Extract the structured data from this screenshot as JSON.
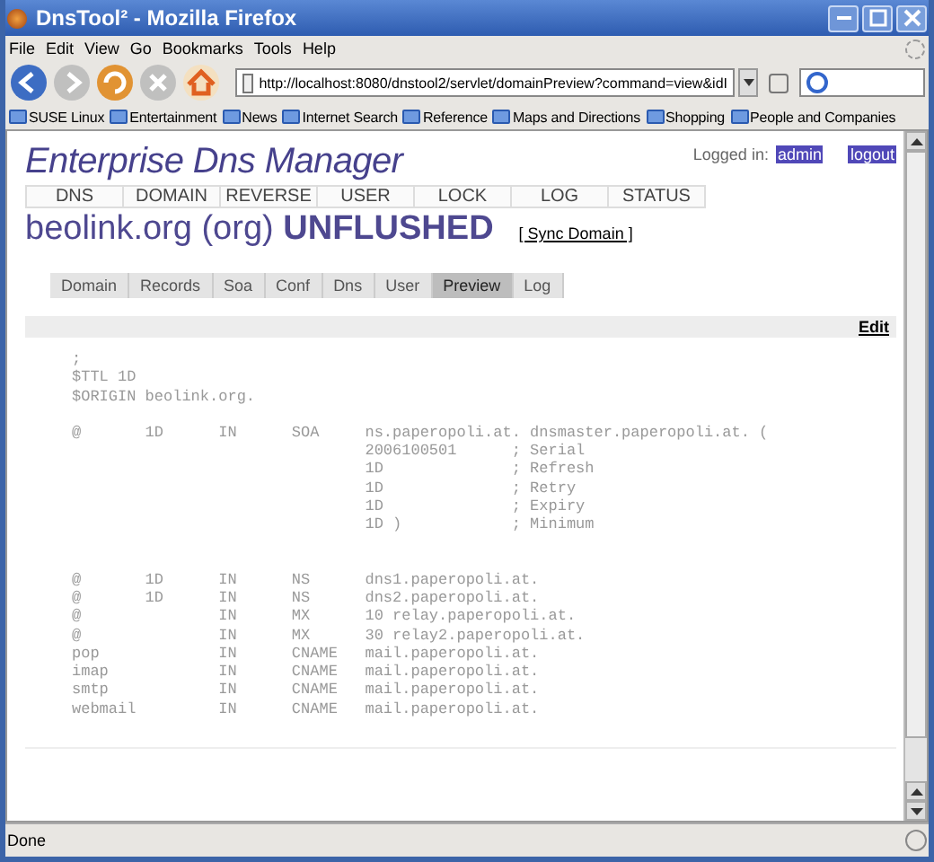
{
  "window": {
    "title": "DnsTool² - Mozilla Firefox"
  },
  "menu": [
    "File",
    "Edit",
    "View",
    "Go",
    "Bookmarks",
    "Tools",
    "Help"
  ],
  "address": {
    "value": "http://localhost:8080/dnstool2/servlet/domainPreview?command=view&idI"
  },
  "bookmarks": [
    "SUSE Linux",
    "Entertainment",
    "News",
    "Internet Search",
    "Reference",
    "Maps and Directions",
    "Shopping",
    "People and Companies"
  ],
  "page": {
    "app_title": "Enterprise Dns Manager",
    "logged_in_label": "Logged in:",
    "user": "admin",
    "logout": "logout",
    "nav": [
      "DNS",
      "DOMAIN",
      "REVERSE",
      "USER",
      "LOCK",
      "LOG",
      "STATUS"
    ],
    "domain": "beolink.org (org)",
    "domain_state": "UNFLUSHED",
    "sync": "[ Sync Domain ]",
    "tabs": [
      {
        "label": "Domain",
        "selected": false
      },
      {
        "label": "Records",
        "selected": false
      },
      {
        "label": "Soa",
        "selected": false
      },
      {
        "label": "Conf",
        "selected": false
      },
      {
        "label": "Dns",
        "selected": false
      },
      {
        "label": "User",
        "selected": false
      },
      {
        "label": "Preview",
        "selected": true
      },
      {
        "label": "Log",
        "selected": false
      }
    ],
    "edit": "Edit",
    "zone_blocks": [
      [
        ";",
        "$TTL 1D",
        "$ORIGIN beolink.org."
      ],
      [
        "@       1D      IN      SOA     ns.paperopoli.at. dnsmaster.paperopoli.at. (",
        "                                2006100501      ; Serial",
        "                                1D              ; Refresh",
        "                                1D              ; Retry",
        "                                1D              ; Expiry",
        "                                1D )            ; Minimum"
      ],
      [
        "@       1D      IN      NS      dns1.paperopoli.at.",
        "@       1D      IN      NS      dns2.paperopoli.at.",
        "@               IN      MX      10 relay.paperopoli.at.",
        "@               IN      MX      30 relay2.paperopoli.at.",
        "pop             IN      CNAME   mail.paperopoli.at.",
        "imap            IN      CNAME   mail.paperopoli.at.",
        "smtp            IN      CNAME   mail.paperopoli.at.",
        "webmail         IN      CNAME   mail.paperopoli.at."
      ]
    ]
  },
  "status_bar": {
    "text": "Done"
  }
}
